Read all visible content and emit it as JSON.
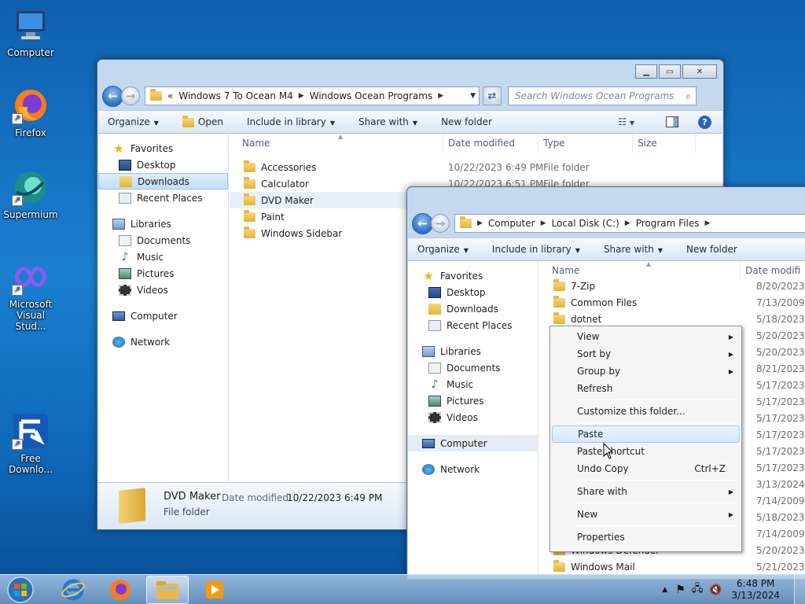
{
  "desktop": {
    "icons": [
      {
        "label": "Computer",
        "icon": "computer-icon"
      },
      {
        "label": "Firefox",
        "icon": "firefox-icon"
      },
      {
        "label": "Supermium",
        "icon": "supermium-icon"
      },
      {
        "label": "Microsoft Visual Stud...",
        "icon": "visual-studio-icon"
      },
      {
        "label": "Free Downlo...",
        "icon": "free-download-manager-icon"
      }
    ]
  },
  "window1": {
    "address": {
      "chevron": "«",
      "segments": [
        "Windows 7 To Ocean M4",
        "Windows Ocean Programs"
      ]
    },
    "search_placeholder": "Search Windows Ocean Programs",
    "toolbar": {
      "organize": "Organize",
      "open": "Open",
      "include": "Include in library",
      "share": "Share with",
      "new_folder": "New folder"
    },
    "nav": {
      "favorites": "Favorites",
      "fav_items": [
        "Desktop",
        "Downloads",
        "Recent Places"
      ],
      "libraries": "Libraries",
      "lib_items": [
        "Documents",
        "Music",
        "Pictures",
        "Videos"
      ],
      "computer": "Computer",
      "network": "Network"
    },
    "columns": {
      "name": "Name",
      "date": "Date modified",
      "type": "Type",
      "size": "Size"
    },
    "rows": [
      {
        "name": "Accessories",
        "date": "10/22/2023 6:49 PM",
        "type": "File folder"
      },
      {
        "name": "Calculator",
        "date": "10/22/2023 6:51 PM",
        "type": "File folder"
      },
      {
        "name": "DVD Maker",
        "date": "",
        "type": ""
      },
      {
        "name": "Paint",
        "date": "",
        "type": ""
      },
      {
        "name": "Windows Sidebar",
        "date": "",
        "type": ""
      }
    ],
    "details": {
      "name": "DVD Maker",
      "date_label": "Date modified:",
      "date": "10/22/2023 6:49 PM",
      "type": "File folder"
    }
  },
  "window2": {
    "address": {
      "segments": [
        "Computer",
        "Local Disk (C:)",
        "Program Files"
      ]
    },
    "toolbar": {
      "organize": "Organize",
      "include": "Include in library",
      "share": "Share with",
      "new_folder": "New folder"
    },
    "nav": {
      "favorites": "Favorites",
      "fav_items": [
        "Desktop",
        "Downloads",
        "Recent Places"
      ],
      "libraries": "Libraries",
      "lib_items": [
        "Documents",
        "Music",
        "Pictures",
        "Videos"
      ],
      "computer": "Computer",
      "network": "Network"
    },
    "columns": {
      "name": "Name",
      "date": "Date modifi"
    },
    "rows": [
      {
        "name": "7-Zip",
        "date": "8/20/2023 1"
      },
      {
        "name": "Common Files",
        "date": "7/13/2009 1"
      },
      {
        "name": "dotnet",
        "date": "5/18/2023 1"
      },
      {
        "name": "",
        "date": "5/20/2023 2"
      },
      {
        "name": "",
        "date": "5/20/2023 7"
      },
      {
        "name": "",
        "date": "8/21/2023 1"
      },
      {
        "name": "",
        "date": "5/17/2023 7"
      },
      {
        "name": "",
        "date": "5/17/2023 7"
      },
      {
        "name": "",
        "date": "5/17/2023 7"
      },
      {
        "name": "",
        "date": "5/17/2023 7"
      },
      {
        "name": "",
        "date": "5/17/2023 7"
      },
      {
        "name": "",
        "date": "5/17/2023 7"
      },
      {
        "name": "",
        "date": "3/13/2024 6"
      },
      {
        "name": "",
        "date": "7/14/2009 1"
      },
      {
        "name": "",
        "date": "5/18/2023 1"
      },
      {
        "name": "",
        "date": "7/14/2009 1"
      },
      {
        "name": "Windows Defender",
        "date": "5/20/2023 2"
      },
      {
        "name": "Windows Mail",
        "date": "5/21/2023 1"
      }
    ]
  },
  "context_menu": {
    "view": "View",
    "sort_by": "Sort by",
    "group_by": "Group by",
    "refresh": "Refresh",
    "customize": "Customize this folder...",
    "paste": "Paste",
    "paste_shortcut": "Paste shortcut",
    "undo_copy": "Undo Copy",
    "undo_shortcut": "Ctrl+Z",
    "share_with": "Share with",
    "new": "New",
    "properties": "Properties"
  },
  "taskbar": {
    "time": "6:48 PM",
    "date": "3/13/2024",
    "pinned": [
      "internet-explorer-icon",
      "firefox-icon",
      "windows-explorer-icon",
      "media-player-icon"
    ]
  }
}
